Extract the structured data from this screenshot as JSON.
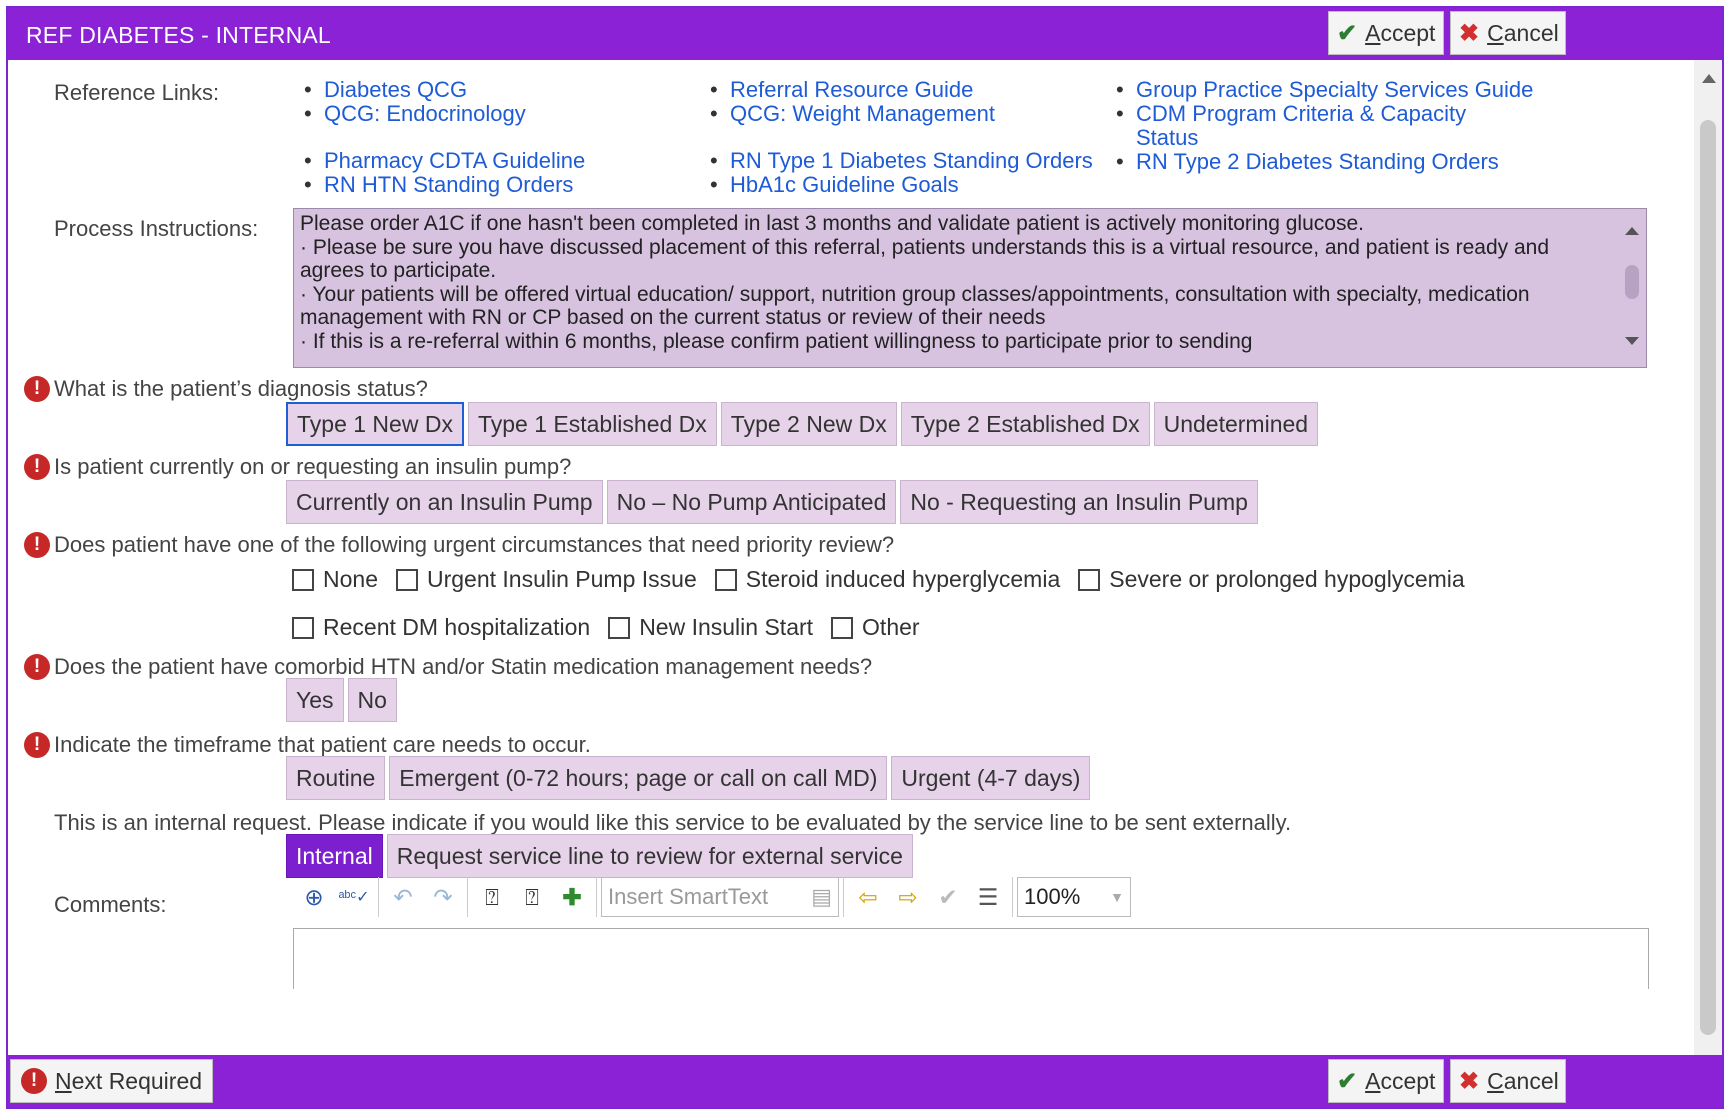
{
  "header": {
    "title": "REF DIABETES - INTERNAL",
    "accept_label": "Accept",
    "accept_hotkey": "A",
    "accept_rest": "ccept",
    "cancel_hotkey": "C",
    "cancel_rest": "ancel"
  },
  "reference_links": {
    "label": "Reference Links:",
    "col1": [
      "Diabetes QCG",
      "QCG: Endocrinology",
      "Pharmacy CDTA Guideline",
      "RN HTN Standing Orders"
    ],
    "col2": [
      "Referral Resource Guide",
      "QCG: Weight Management",
      "RN Type 1 Diabetes Standing Orders",
      "HbA1c Guideline Goals"
    ],
    "col3": [
      "Group Practice Specialty Services Guide",
      "CDM Program Criteria & Capacity Status",
      "RN Type 2 Diabetes Standing Orders"
    ]
  },
  "process": {
    "label": "Process Instructions:",
    "lines": [
      "Please order A1C if one hasn't been completed in last 3 months and validate patient is actively monitoring glucose.",
      "·       Please be sure you have discussed placement of this referral, patients understands this is a virtual resource, and patient is ready and agrees to participate.",
      "·       Your patients will be offered virtual education/ support, nutrition group classes/appointments, consultation with specialty, medication management with RN or CP based on the current status or review of their needs",
      "·       If this is a re-referral within 6 months, please confirm patient willingness to participate prior to sending"
    ]
  },
  "q1": {
    "text": "What is the patient’s diagnosis status?",
    "options": [
      "Type 1 New Dx",
      "Type 1 Established Dx",
      "Type 2 New Dx",
      "Type 2 Established Dx",
      "Undetermined"
    ]
  },
  "q2": {
    "text": "Is patient currently on or requesting an insulin pump?",
    "options": [
      "Currently on an Insulin Pump",
      "No – No Pump Anticipated",
      "No - Requesting an Insulin Pump"
    ]
  },
  "q3": {
    "text": "Does patient have one of the following urgent circumstances that need priority review?",
    "row1": [
      "None",
      "Urgent Insulin Pump Issue",
      "Steroid induced hyperglycemia",
      "Severe or prolonged hypoglycemia"
    ],
    "row2": [
      "Recent DM hospitalization",
      "New Insulin Start",
      "Other"
    ]
  },
  "q4": {
    "text": "Does the patient have comorbid HTN and/or Statin medication management needs?",
    "options": [
      "Yes",
      "No"
    ]
  },
  "q5": {
    "text": "Indicate the timeframe that patient care needs to occur.",
    "options": [
      "Routine",
      "Emergent (0-72 hours; page or call on call MD)",
      "Urgent (4-7 days)"
    ]
  },
  "internal": {
    "text": "This is an internal request. Please indicate if you would like this service to be evaluated by the service line to be sent externally.",
    "options": [
      "Internal",
      "Request service line to review for external service"
    ],
    "selected": "Internal"
  },
  "comments": {
    "label": "Comments:",
    "smarttext_placeholder": "Insert SmartText",
    "zoom": "100%"
  },
  "footer": {
    "next_required_hotkey": "N",
    "next_required_rest": "ext Required"
  }
}
